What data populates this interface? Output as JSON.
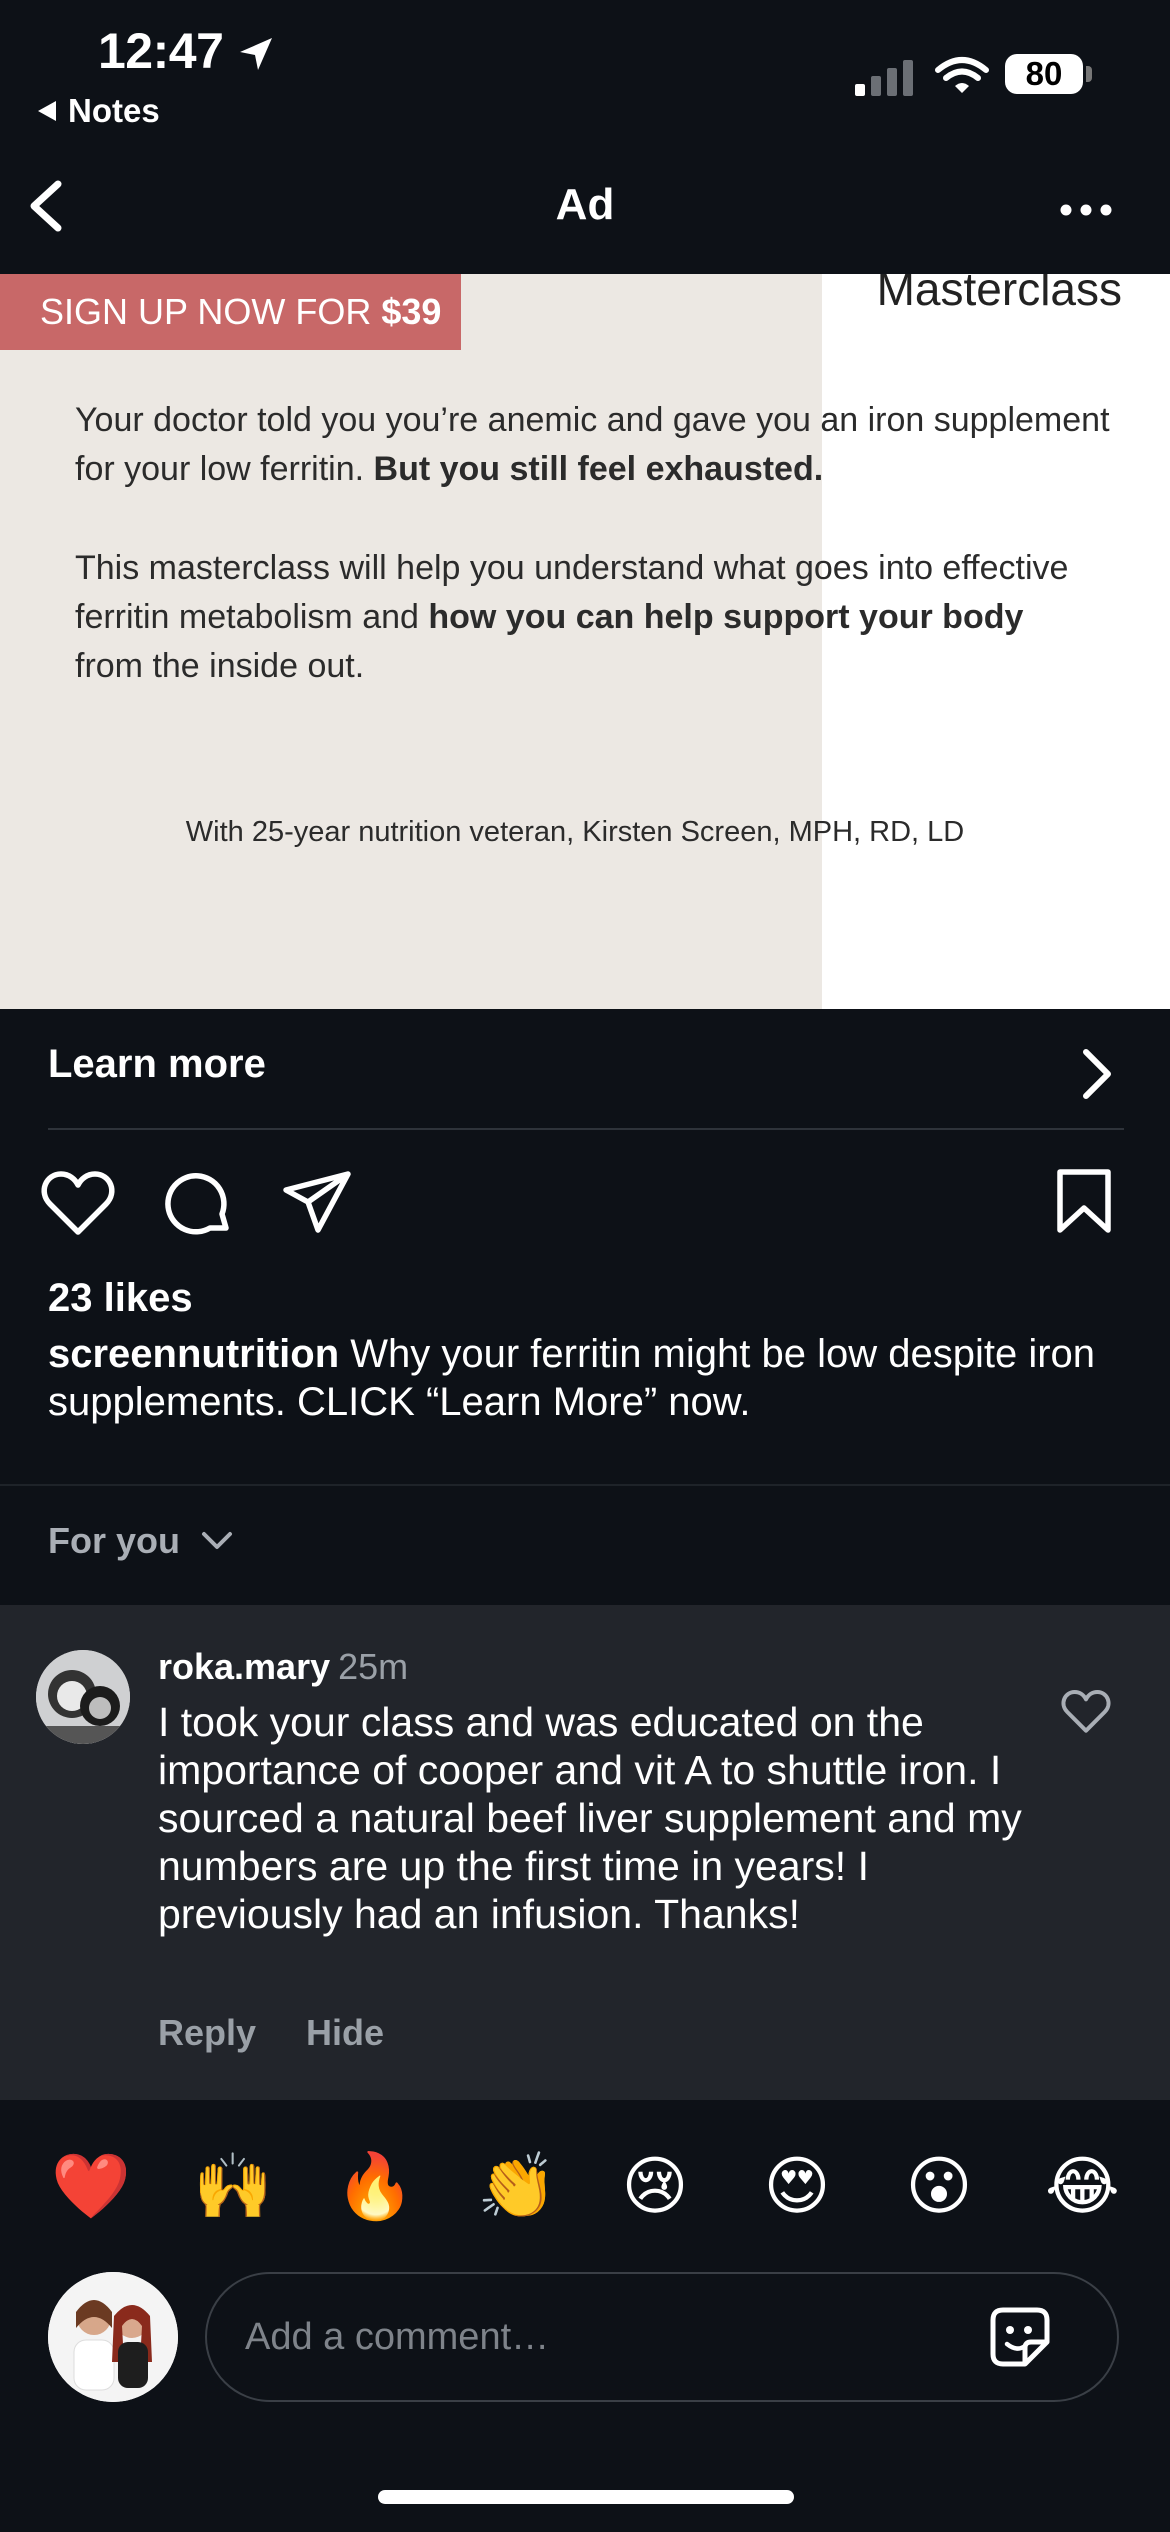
{
  "status_bar": {
    "time": "12:47",
    "back_app": "Notes",
    "battery": "80"
  },
  "nav": {
    "title": "Ad"
  },
  "ad_image": {
    "brand_text": "Masterclass",
    "banner_prefix": "SIGN UP NOW FOR",
    "banner_price": "$39",
    "para1_normal": "Your doctor told you you’re anemic and gave you an iron supplement for your low ferritin. ",
    "para1_bold": "But you still feel exhausted.",
    "para2_a": "This masterclass will help you understand what goes into effective ferritin metabolism and ",
    "para2_bold": "how you can help support your body",
    "para2_b": " from the inside out.",
    "credit": "With 25-year nutrition veteran, Kirsten Screen, MPH, RD, LD"
  },
  "cta": {
    "label": "Learn more"
  },
  "post": {
    "likes": "23 likes",
    "caption_user": "screennutrition",
    "caption_text": " Why your ferritin might be low despite iron supplements. CLICK “Learn More” now."
  },
  "comments_filter": {
    "label": "For you"
  },
  "comment": {
    "username": "roka.mary",
    "time": "25m",
    "text": "I took your class and was educated on the importance of cooper and vit A to shuttle iron. I sourced a natural beef liver supplement and my numbers are up the first time in years! I previously had an infusion. Thanks!",
    "reply_label": "Reply",
    "hide_label": "Hide"
  },
  "emoji_bar": [
    "❤️",
    "🙌",
    "🔥",
    "👏",
    "😢",
    "😍",
    "😮",
    "😂"
  ],
  "comment_input": {
    "placeholder": "Add a comment…"
  },
  "colors": {
    "background": "#0d1117",
    "comment_bg": "#22252b",
    "banner": "#c86868",
    "ad_panel": "#ece8e3",
    "muted_text": "#9aa0a7"
  },
  "icons": [
    "location-arrow-icon",
    "back-triangle-icon",
    "signal-icon",
    "wifi-icon",
    "battery-icon",
    "back-chevron-icon",
    "more-icon",
    "chevron-right-icon",
    "heart-icon",
    "comment-icon",
    "share-icon",
    "bookmark-icon",
    "chevron-down-icon",
    "sticker-icon"
  ]
}
